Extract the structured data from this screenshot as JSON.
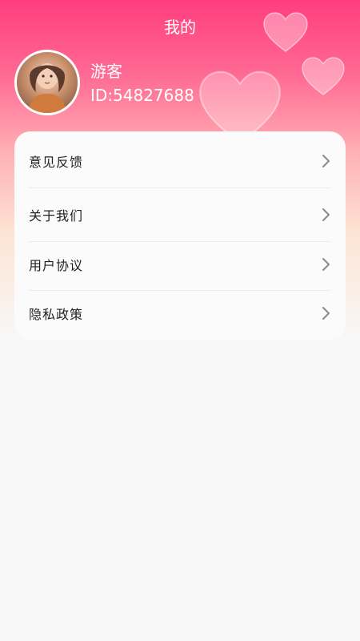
{
  "header": {
    "title": "我的"
  },
  "profile": {
    "name": "游客",
    "id_text": "ID:54827688"
  },
  "menu": {
    "items": [
      {
        "label": "意见反馈"
      },
      {
        "label": "关于我们"
      },
      {
        "label": "用户协议"
      },
      {
        "label": "隐私政策"
      }
    ]
  },
  "colors": {
    "header_pink": "#ff3d7f",
    "card_bg": "#fbfbfb",
    "page_bg": "#f8f8f8"
  }
}
